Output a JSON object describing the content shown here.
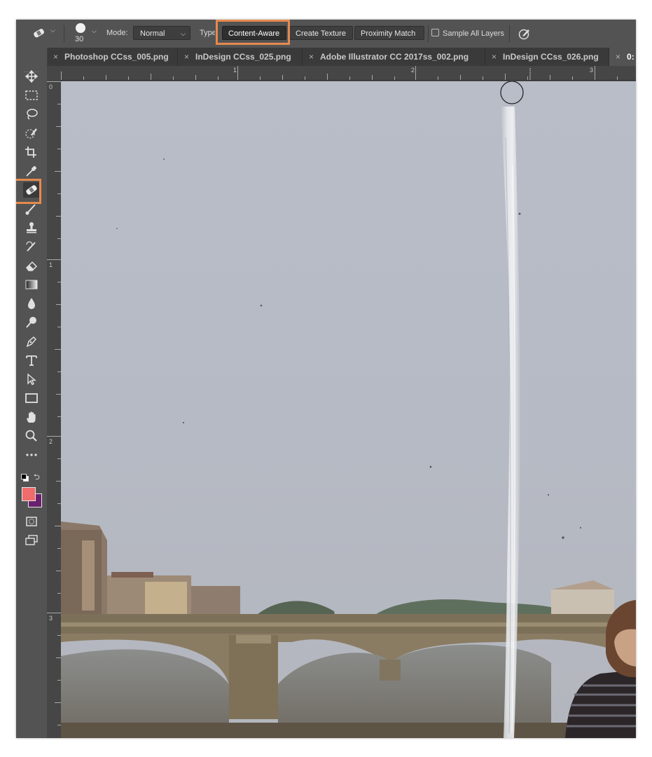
{
  "options_bar": {
    "tool_icon": "spot-healing-brush-icon",
    "brush_size": "30",
    "mode_label": "Mode:",
    "mode_value": "Normal",
    "type_label": "Type:",
    "type_buttons": [
      "Content-Aware",
      "Create Texture",
      "Proximity Match"
    ],
    "selected_type": "Content-Aware",
    "sample_all_layers_label": "Sample All Layers",
    "sample_all_layers_checked": false,
    "pressure_icon": "pressure-size-icon"
  },
  "toolbar_toggle": "››",
  "tabs": [
    {
      "label": "Photoshop CCss_005.png"
    },
    {
      "label": "InDesign CCss_025.png"
    },
    {
      "label": "Adobe Illustrator CC 2017ss_002.png"
    },
    {
      "label": "InDesign CCss_026.png"
    },
    {
      "label": "0:"
    }
  ],
  "tools": [
    "move-icon",
    "marquee-icon",
    "lasso-icon",
    "quick-selection-icon",
    "crop-icon",
    "eyedropper-icon",
    "spot-healing-brush-icon",
    "brush-icon",
    "clone-stamp-icon",
    "history-brush-icon",
    "eraser-icon",
    "gradient-icon",
    "blur-icon",
    "dodge-icon",
    "pen-icon",
    "type-icon",
    "path-selection-icon",
    "rectangle-icon",
    "hand-icon",
    "zoom-icon",
    "more-tools-icon"
  ],
  "active_tool": "spot-healing-brush-icon",
  "colors": {
    "foreground": "#f06b6b",
    "background": "#6b1f6f",
    "highlight": "#e58a4f"
  },
  "rulers": {
    "top": [
      "1",
      "2",
      "3"
    ],
    "left": [
      "0",
      "1",
      "2",
      "3"
    ]
  }
}
